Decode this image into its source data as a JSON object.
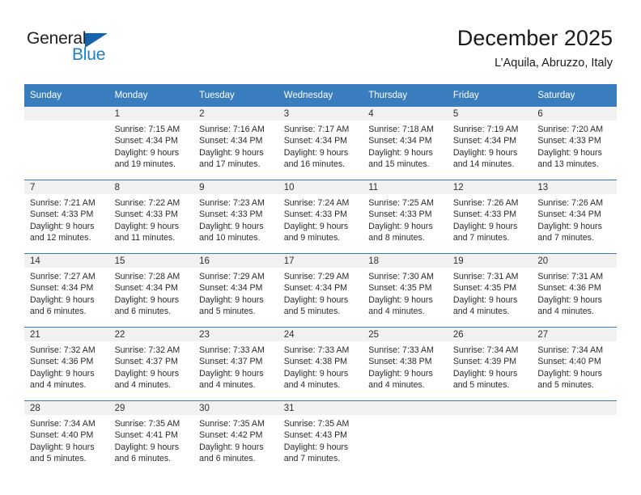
{
  "brand": {
    "name_top": "General",
    "name_bottom": "Blue",
    "accent_color": "#1f7ec4",
    "triangle_color": "#1464ad"
  },
  "header": {
    "title": "December 2025",
    "subtitle": "L’Aquila, Abruzzo, Italy"
  },
  "theme": {
    "header_row_bg": "#3a7dbf",
    "daynum_band_bg": "#f1f1f1",
    "grid_line": "#3a7dbf",
    "text": "#2b2b2b"
  },
  "weekdays": [
    "Sunday",
    "Monday",
    "Tuesday",
    "Wednesday",
    "Thursday",
    "Friday",
    "Saturday"
  ],
  "weeks": [
    [
      {
        "day": "",
        "sunrise": "",
        "sunset": "",
        "daylight1": "",
        "daylight2": ""
      },
      {
        "day": "1",
        "sunrise": "Sunrise: 7:15 AM",
        "sunset": "Sunset: 4:34 PM",
        "daylight1": "Daylight: 9 hours",
        "daylight2": "and 19 minutes."
      },
      {
        "day": "2",
        "sunrise": "Sunrise: 7:16 AM",
        "sunset": "Sunset: 4:34 PM",
        "daylight1": "Daylight: 9 hours",
        "daylight2": "and 17 minutes."
      },
      {
        "day": "3",
        "sunrise": "Sunrise: 7:17 AM",
        "sunset": "Sunset: 4:34 PM",
        "daylight1": "Daylight: 9 hours",
        "daylight2": "and 16 minutes."
      },
      {
        "day": "4",
        "sunrise": "Sunrise: 7:18 AM",
        "sunset": "Sunset: 4:34 PM",
        "daylight1": "Daylight: 9 hours",
        "daylight2": "and 15 minutes."
      },
      {
        "day": "5",
        "sunrise": "Sunrise: 7:19 AM",
        "sunset": "Sunset: 4:34 PM",
        "daylight1": "Daylight: 9 hours",
        "daylight2": "and 14 minutes."
      },
      {
        "day": "6",
        "sunrise": "Sunrise: 7:20 AM",
        "sunset": "Sunset: 4:33 PM",
        "daylight1": "Daylight: 9 hours",
        "daylight2": "and 13 minutes."
      }
    ],
    [
      {
        "day": "7",
        "sunrise": "Sunrise: 7:21 AM",
        "sunset": "Sunset: 4:33 PM",
        "daylight1": "Daylight: 9 hours",
        "daylight2": "and 12 minutes."
      },
      {
        "day": "8",
        "sunrise": "Sunrise: 7:22 AM",
        "sunset": "Sunset: 4:33 PM",
        "daylight1": "Daylight: 9 hours",
        "daylight2": "and 11 minutes."
      },
      {
        "day": "9",
        "sunrise": "Sunrise: 7:23 AM",
        "sunset": "Sunset: 4:33 PM",
        "daylight1": "Daylight: 9 hours",
        "daylight2": "and 10 minutes."
      },
      {
        "day": "10",
        "sunrise": "Sunrise: 7:24 AM",
        "sunset": "Sunset: 4:33 PM",
        "daylight1": "Daylight: 9 hours",
        "daylight2": "and 9 minutes."
      },
      {
        "day": "11",
        "sunrise": "Sunrise: 7:25 AM",
        "sunset": "Sunset: 4:33 PM",
        "daylight1": "Daylight: 9 hours",
        "daylight2": "and 8 minutes."
      },
      {
        "day": "12",
        "sunrise": "Sunrise: 7:26 AM",
        "sunset": "Sunset: 4:33 PM",
        "daylight1": "Daylight: 9 hours",
        "daylight2": "and 7 minutes."
      },
      {
        "day": "13",
        "sunrise": "Sunrise: 7:26 AM",
        "sunset": "Sunset: 4:34 PM",
        "daylight1": "Daylight: 9 hours",
        "daylight2": "and 7 minutes."
      }
    ],
    [
      {
        "day": "14",
        "sunrise": "Sunrise: 7:27 AM",
        "sunset": "Sunset: 4:34 PM",
        "daylight1": "Daylight: 9 hours",
        "daylight2": "and 6 minutes."
      },
      {
        "day": "15",
        "sunrise": "Sunrise: 7:28 AM",
        "sunset": "Sunset: 4:34 PM",
        "daylight1": "Daylight: 9 hours",
        "daylight2": "and 6 minutes."
      },
      {
        "day": "16",
        "sunrise": "Sunrise: 7:29 AM",
        "sunset": "Sunset: 4:34 PM",
        "daylight1": "Daylight: 9 hours",
        "daylight2": "and 5 minutes."
      },
      {
        "day": "17",
        "sunrise": "Sunrise: 7:29 AM",
        "sunset": "Sunset: 4:34 PM",
        "daylight1": "Daylight: 9 hours",
        "daylight2": "and 5 minutes."
      },
      {
        "day": "18",
        "sunrise": "Sunrise: 7:30 AM",
        "sunset": "Sunset: 4:35 PM",
        "daylight1": "Daylight: 9 hours",
        "daylight2": "and 4 minutes."
      },
      {
        "day": "19",
        "sunrise": "Sunrise: 7:31 AM",
        "sunset": "Sunset: 4:35 PM",
        "daylight1": "Daylight: 9 hours",
        "daylight2": "and 4 minutes."
      },
      {
        "day": "20",
        "sunrise": "Sunrise: 7:31 AM",
        "sunset": "Sunset: 4:36 PM",
        "daylight1": "Daylight: 9 hours",
        "daylight2": "and 4 minutes."
      }
    ],
    [
      {
        "day": "21",
        "sunrise": "Sunrise: 7:32 AM",
        "sunset": "Sunset: 4:36 PM",
        "daylight1": "Daylight: 9 hours",
        "daylight2": "and 4 minutes."
      },
      {
        "day": "22",
        "sunrise": "Sunrise: 7:32 AM",
        "sunset": "Sunset: 4:37 PM",
        "daylight1": "Daylight: 9 hours",
        "daylight2": "and 4 minutes."
      },
      {
        "day": "23",
        "sunrise": "Sunrise: 7:33 AM",
        "sunset": "Sunset: 4:37 PM",
        "daylight1": "Daylight: 9 hours",
        "daylight2": "and 4 minutes."
      },
      {
        "day": "24",
        "sunrise": "Sunrise: 7:33 AM",
        "sunset": "Sunset: 4:38 PM",
        "daylight1": "Daylight: 9 hours",
        "daylight2": "and 4 minutes."
      },
      {
        "day": "25",
        "sunrise": "Sunrise: 7:33 AM",
        "sunset": "Sunset: 4:38 PM",
        "daylight1": "Daylight: 9 hours",
        "daylight2": "and 4 minutes."
      },
      {
        "day": "26",
        "sunrise": "Sunrise: 7:34 AM",
        "sunset": "Sunset: 4:39 PM",
        "daylight1": "Daylight: 9 hours",
        "daylight2": "and 5 minutes."
      },
      {
        "day": "27",
        "sunrise": "Sunrise: 7:34 AM",
        "sunset": "Sunset: 4:40 PM",
        "daylight1": "Daylight: 9 hours",
        "daylight2": "and 5 minutes."
      }
    ],
    [
      {
        "day": "28",
        "sunrise": "Sunrise: 7:34 AM",
        "sunset": "Sunset: 4:40 PM",
        "daylight1": "Daylight: 9 hours",
        "daylight2": "and 5 minutes."
      },
      {
        "day": "29",
        "sunrise": "Sunrise: 7:35 AM",
        "sunset": "Sunset: 4:41 PM",
        "daylight1": "Daylight: 9 hours",
        "daylight2": "and 6 minutes."
      },
      {
        "day": "30",
        "sunrise": "Sunrise: 7:35 AM",
        "sunset": "Sunset: 4:42 PM",
        "daylight1": "Daylight: 9 hours",
        "daylight2": "and 6 minutes."
      },
      {
        "day": "31",
        "sunrise": "Sunrise: 7:35 AM",
        "sunset": "Sunset: 4:43 PM",
        "daylight1": "Daylight: 9 hours",
        "daylight2": "and 7 minutes."
      },
      {
        "day": "",
        "sunrise": "",
        "sunset": "",
        "daylight1": "",
        "daylight2": ""
      },
      {
        "day": "",
        "sunrise": "",
        "sunset": "",
        "daylight1": "",
        "daylight2": ""
      },
      {
        "day": "",
        "sunrise": "",
        "sunset": "",
        "daylight1": "",
        "daylight2": ""
      }
    ]
  ]
}
